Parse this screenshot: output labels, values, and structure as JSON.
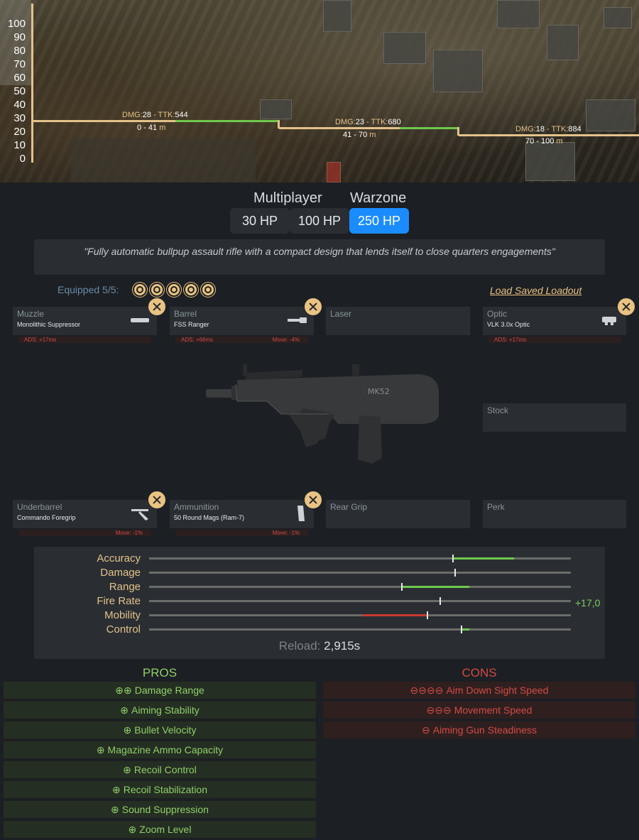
{
  "graph": {
    "y_ticks": [
      "100",
      "90",
      "80",
      "70",
      "60",
      "50",
      "40",
      "30",
      "20",
      "10",
      "0"
    ],
    "ranges": [
      {
        "dmg_key": "DMG:",
        "dmg": "28",
        "ttk_key": " - TTK:",
        "ttk": "544",
        "range": "0 - 41",
        "unit": " m"
      },
      {
        "dmg_key": "DMG:",
        "dmg": "23",
        "ttk_key": " - TTK:",
        "ttk": "680",
        "range": "41 - 70",
        "unit": " m"
      },
      {
        "dmg_key": "DMG:",
        "dmg": "18",
        "ttk_key": " - TTK:",
        "ttk": "884",
        "range": "70 - 100",
        "unit": " m"
      }
    ]
  },
  "modes": {
    "multiplayer_label": "Multiplayer",
    "warzone_label": "Warzone",
    "hp_30": "30 HP",
    "hp_100": "100 HP",
    "hp_250": "250 HP"
  },
  "description": "\"Fully automatic bullpup assault rifle with a compact design that lends itself to close quarters engagements\"",
  "loadout": {
    "equipped_label": "Equipped 5/5:",
    "load_saved": "Load Saved Loadout",
    "slots": {
      "muzzle": {
        "name": "Muzzle",
        "value": "Monolithic Suppressor",
        "ads": "ADS: +17ms",
        "move": ""
      },
      "barrel": {
        "name": "Barrel",
        "value": "FSS Ranger",
        "ads": "ADS: +66ms",
        "move": "Move: -4%"
      },
      "laser": {
        "name": "Laser",
        "value": ""
      },
      "optic": {
        "name": "Optic",
        "value": "VLK 3.0x Optic",
        "ads": "ADS: +17ms",
        "move": ""
      },
      "stock": {
        "name": "Stock",
        "value": ""
      },
      "underbarrel": {
        "name": "Underbarrel",
        "value": "Commando Foregrip",
        "move": "Move: -1%"
      },
      "ammunition": {
        "name": "Ammunition",
        "value": "50 Round Mags (Ram-7)",
        "move": "Move: -1%"
      },
      "reargrip": {
        "name": "Rear Grip",
        "value": ""
      },
      "perk": {
        "name": "Perk",
        "value": ""
      }
    }
  },
  "stats": {
    "accuracy": "Accuracy",
    "damage": "Damage",
    "range": "Range",
    "fire_rate": "Fire Rate",
    "mobility": "Mobility",
    "control": "Control",
    "fire_rate_delta": "+17,0",
    "reload_label": "Reload:",
    "reload_value": "2,915s"
  },
  "pros_title": "PROS",
  "cons_title": "CONS",
  "pros": [
    {
      "sym": "⊕⊕",
      "text": "Damage Range"
    },
    {
      "sym": "⊕",
      "text": "Aiming Stability"
    },
    {
      "sym": "⊕",
      "text": "Bullet Velocity"
    },
    {
      "sym": "⊕",
      "text": "Magazine Ammo Capacity"
    },
    {
      "sym": "⊕",
      "text": "Recoil Control"
    },
    {
      "sym": "⊕",
      "text": "Recoil Stabilization"
    },
    {
      "sym": "⊕",
      "text": "Sound Suppression"
    },
    {
      "sym": "⊕",
      "text": "Zoom Level"
    }
  ],
  "cons": [
    {
      "sym": "⊖⊖⊖⊖",
      "text": "Aim Down Sight Speed"
    },
    {
      "sym": "⊖⊖⊖",
      "text": "Movement Speed"
    },
    {
      "sym": "⊖",
      "text": "Aiming Gun Steadiness"
    }
  ],
  "colors": {
    "accent": "#1a8cff",
    "gold": "#e3c28a",
    "pro_green": "#8fcf6a",
    "con_red": "#d24b45"
  }
}
